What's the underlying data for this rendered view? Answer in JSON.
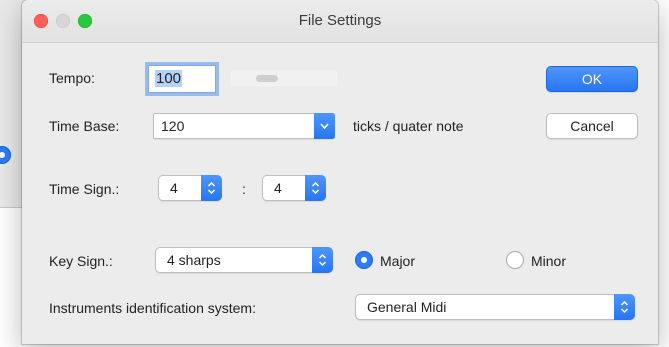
{
  "window": {
    "title": "File Settings"
  },
  "tempo": {
    "label": "Tempo:",
    "value": "100",
    "slider_level": 0.3
  },
  "time_base": {
    "label": "Time Base:",
    "value": "120",
    "unit": "ticks / quater note"
  },
  "time_signature": {
    "label": "Time Sign.:",
    "numerator": "4",
    "separator": ":",
    "denominator": "4"
  },
  "key_signature": {
    "label": "Key Sign.:",
    "value": "4 sharps",
    "mode_major": "Major",
    "mode_minor": "Minor",
    "selected_mode": "Major"
  },
  "instruments": {
    "label": "Instruments identification system:",
    "value": "General Midi"
  },
  "buttons": {
    "ok": "OK",
    "cancel": "Cancel"
  },
  "colors": {
    "accent": "#2776f0",
    "close": "#ff5f57",
    "maximize": "#28c840"
  },
  "icons": {
    "popup_arrow": "chevron-updown-icon",
    "combo_arrow": "chevron-down-icon"
  }
}
